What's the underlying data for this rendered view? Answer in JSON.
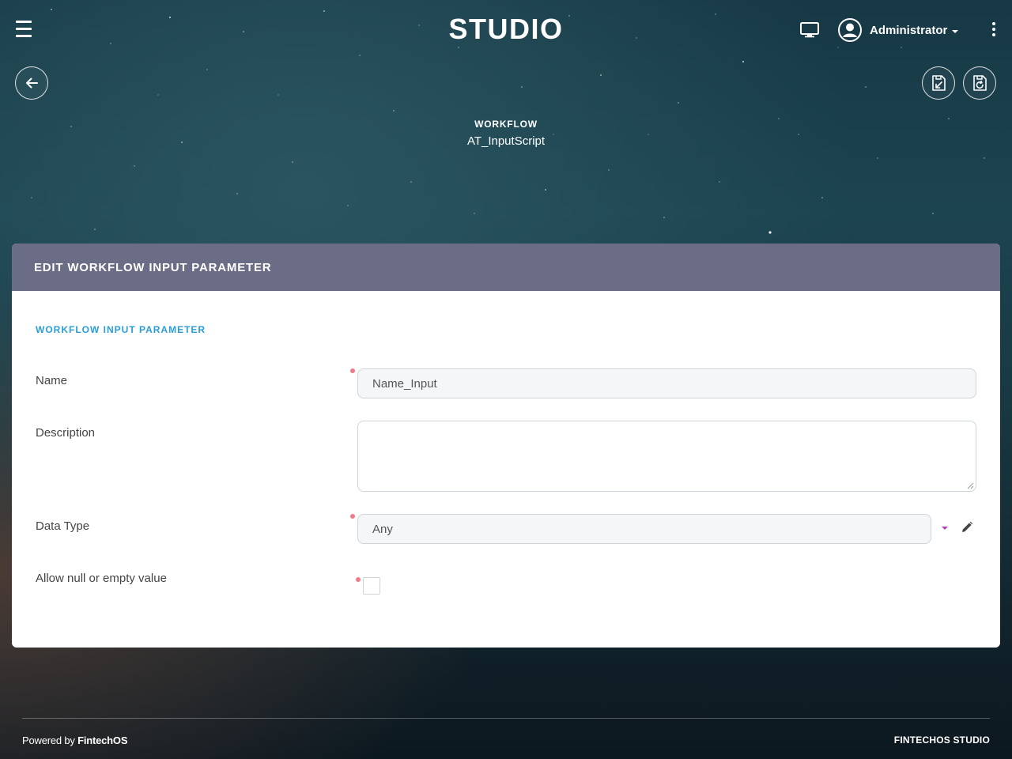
{
  "app": {
    "logo": "STUDIO"
  },
  "header": {
    "user_name": "Administrator"
  },
  "entity": {
    "type": "WORKFLOW",
    "name": "AT_InputScript"
  },
  "form": {
    "title": "EDIT WORKFLOW INPUT PARAMETER",
    "section_title": "WORKFLOW INPUT PARAMETER",
    "fields": {
      "name": {
        "label": "Name",
        "value": "Name_Input",
        "required": true
      },
      "description": {
        "label": "Description",
        "value": "",
        "required": false
      },
      "data_type": {
        "label": "Data Type",
        "value": "Any",
        "required": true
      },
      "allow_null": {
        "label": "Allow null or empty value",
        "checked": false,
        "required": true
      }
    }
  },
  "footer": {
    "powered_prefix": "Powered by",
    "powered_brand": "FintechOS",
    "right_brand": "FINTECHOS STUDIO"
  },
  "colors": {
    "card_header": "#6b6d86",
    "section_title": "#2a9dd8",
    "required_dot": "#f07a8a",
    "dropdown_caret": "#b040b8"
  }
}
